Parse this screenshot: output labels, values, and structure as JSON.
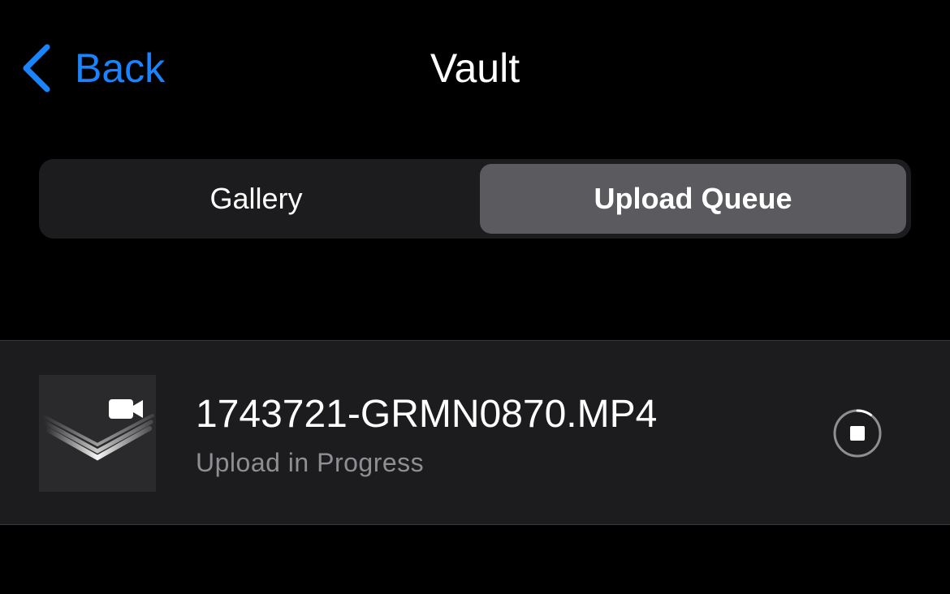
{
  "nav": {
    "back_label": "Back",
    "title": "Vault"
  },
  "segments": [
    {
      "label": "Gallery",
      "selected": false
    },
    {
      "label": "Upload Queue",
      "selected": true
    }
  ],
  "queue": [
    {
      "file_name": "1743721-GRMN0870.MP4",
      "status": "Upload in Progress",
      "progress": 0.1,
      "thumbnail_icon": "video-camera-icon"
    }
  ],
  "colors": {
    "accent": "#1a84ff",
    "background": "#000000",
    "row_background": "#1c1c1e",
    "selected_segment": "#5a5a5f",
    "secondary_text": "#8e8e93"
  },
  "icons": {
    "back": "chevron-left-icon",
    "stop": "stop-icon",
    "thumbnail": "video-camera-icon"
  }
}
